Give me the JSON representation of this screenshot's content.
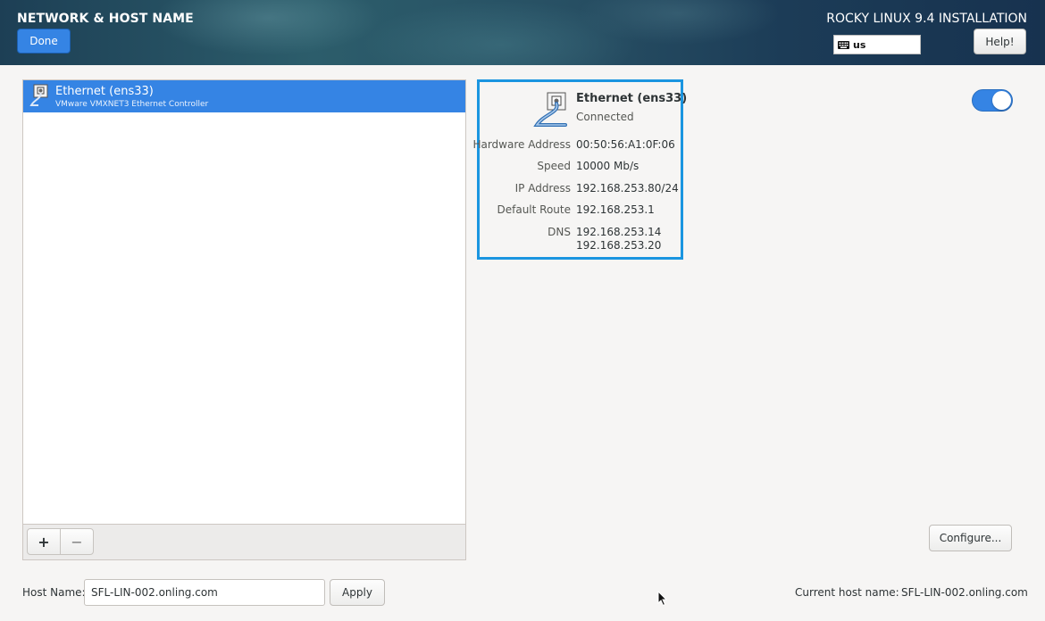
{
  "header": {
    "title": "NETWORK & HOST NAME",
    "done_label": "Done",
    "install_title": "ROCKY LINUX 9.4 INSTALLATION",
    "keyboard_layout": "us",
    "help_label": "Help!"
  },
  "devices": [
    {
      "name": "Ethernet (ens33)",
      "description": "VMware VMXNET3 Ethernet Controller",
      "selected": true
    }
  ],
  "list_toolbar": {
    "add_label": "+",
    "remove_label": "−"
  },
  "details": {
    "name": "Ethernet (ens33)",
    "status": "Connected",
    "rows": [
      {
        "label": "Hardware Address",
        "value": "00:50:56:A1:0F:06"
      },
      {
        "label": "Speed",
        "value": "10000 Mb/s"
      },
      {
        "label": "IP Address",
        "value": "192.168.253.80/24"
      },
      {
        "label": "Default Route",
        "value": "192.168.253.1"
      },
      {
        "label": "DNS",
        "value": "192.168.253.14",
        "value2": "192.168.253.20"
      }
    ],
    "enabled": true,
    "configure_label": "Configure..."
  },
  "hostname": {
    "label": "Host Name:",
    "value": "SFL-LIN-002.onling.com",
    "apply_label": "Apply",
    "current_label": "Current host name:",
    "current_value": "SFL-LIN-002.onling.com"
  },
  "colors": {
    "accent": "#3584e4",
    "selection_border": "#1a95e0"
  }
}
